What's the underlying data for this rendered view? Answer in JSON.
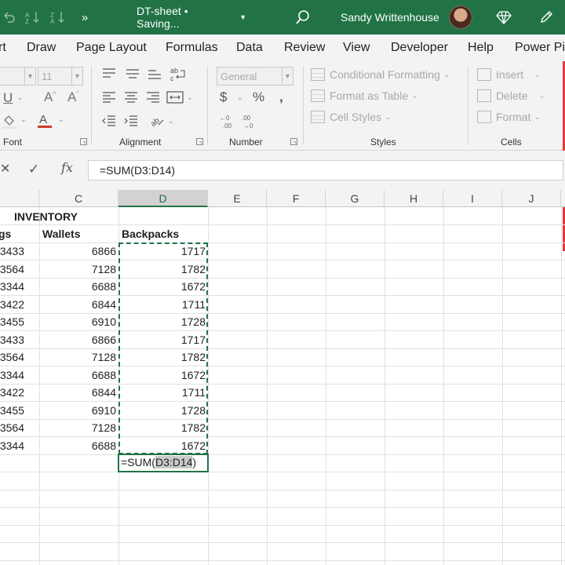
{
  "titlebar": {
    "title": "DT-sheet • Saving...",
    "user_name": "Sandy Writtenhouse",
    "more_label": "»"
  },
  "tabs": [
    "rt",
    "Draw",
    "Page Layout",
    "Formulas",
    "Data",
    "Review",
    "View",
    "Developer",
    "Help",
    "Power Pivot"
  ],
  "ribbon": {
    "font_size_value": "11",
    "number_format_value": "General",
    "groups": {
      "font": "Font",
      "alignment": "Alignment",
      "number": "Number",
      "styles": "Styles",
      "cells": "Cells"
    },
    "styles_items": [
      "Conditional Formatting",
      "Format as Table",
      "Cell Styles"
    ],
    "cells_items": [
      "Insert",
      "Delete",
      "Format"
    ]
  },
  "formula_bar": {
    "formula": "=SUM(D3:D14)"
  },
  "columns": [
    "C",
    "D",
    "E",
    "F",
    "G",
    "H",
    "I",
    "J"
  ],
  "sheet": {
    "title": "INVENTORY",
    "headers": {
      "b": "gs",
      "c": "Wallets",
      "d": "Backpacks"
    },
    "rows": [
      [
        "3433",
        "6866",
        "1717"
      ],
      [
        "3564",
        "7128",
        "1782"
      ],
      [
        "3344",
        "6688",
        "1672"
      ],
      [
        "3422",
        "6844",
        "1711"
      ],
      [
        "3455",
        "6910",
        "1728"
      ],
      [
        "3433",
        "6866",
        "1717"
      ],
      [
        "3564",
        "7128",
        "1782"
      ],
      [
        "3344",
        "6688",
        "1672"
      ],
      [
        "3422",
        "6844",
        "1711"
      ],
      [
        "3455",
        "6910",
        "1728"
      ],
      [
        "3564",
        "7128",
        "1782"
      ],
      [
        "3344",
        "6688",
        "1672"
      ]
    ],
    "active_cell": {
      "prefix": "=SUM(",
      "ref": "D3:D14",
      "suffix": ")"
    }
  },
  "colors": {
    "excel_green": "#217346",
    "ribbon_bg": "#f3f3f3"
  }
}
